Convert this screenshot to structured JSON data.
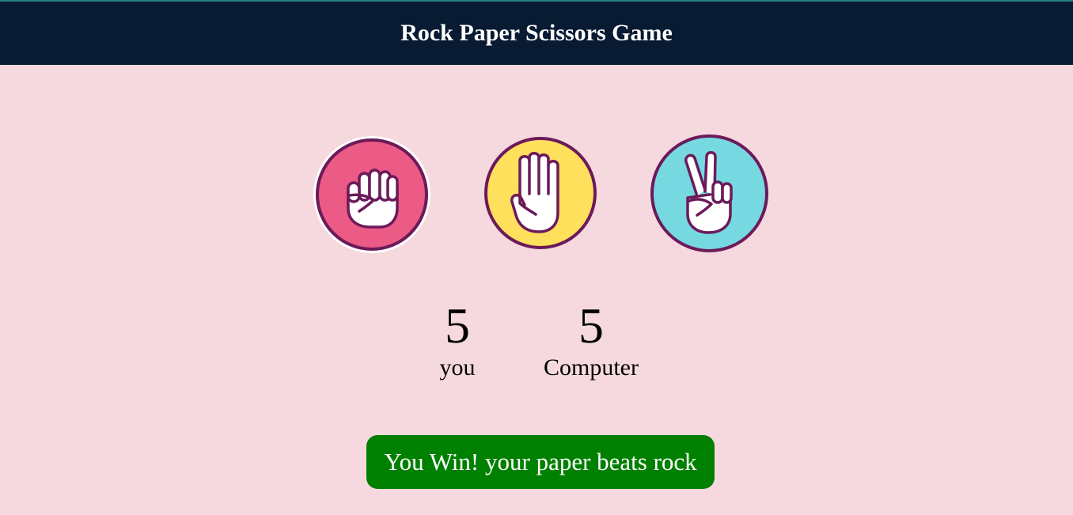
{
  "header": {
    "title": "Rock Paper Scissors Game"
  },
  "choices": [
    {
      "id": "rock",
      "icon": "rock-fist-icon",
      "color": "#ec5a86"
    },
    {
      "id": "paper",
      "icon": "paper-hand-icon",
      "color": "#ffe05c"
    },
    {
      "id": "scissors",
      "icon": "scissors-hand-icon",
      "color": "#76d9e1"
    }
  ],
  "scoreboard": {
    "user_score": "5",
    "user_label": "you",
    "computer_score": "5",
    "computer_label": "Computer"
  },
  "message": {
    "text": "You Win! your paper beats rock",
    "color": "#008000"
  },
  "colors": {
    "background": "#f6d9df",
    "header": "#081b33",
    "outline": "#6b1a5a"
  }
}
